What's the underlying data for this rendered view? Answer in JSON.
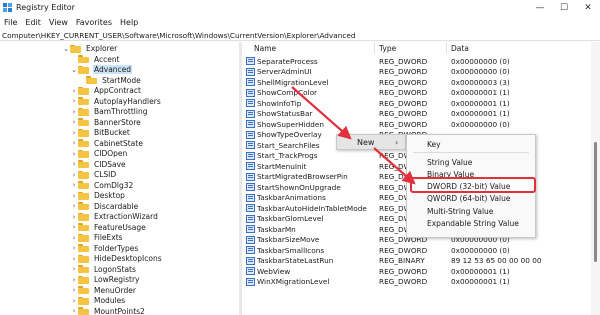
{
  "window": {
    "title": "Registry Editor",
    "controls": {
      "minimize": "—",
      "maximize": "☐",
      "close": "✕"
    }
  },
  "menu": [
    "File",
    "Edit",
    "View",
    "Favorites",
    "Help"
  ],
  "address": "Computer\\HKEY_CURRENT_USER\\Software\\Microsoft\\Windows\\CurrentVersion\\Explorer\\Advanced",
  "tree": [
    {
      "label": "Explorer",
      "expanded": true,
      "level": 0
    },
    {
      "label": "Accent",
      "expanded": false,
      "level": 1,
      "no_arrow": true
    },
    {
      "label": "Advanced",
      "expanded": true,
      "level": 1,
      "selected": true
    },
    {
      "label": "StartMode",
      "expanded": false,
      "level": 2,
      "no_arrow": true
    },
    {
      "label": "AppContract",
      "expanded": false,
      "level": 1
    },
    {
      "label": "AutoplayHandlers",
      "expanded": false,
      "level": 1
    },
    {
      "label": "BamThrottling",
      "expanded": false,
      "level": 1
    },
    {
      "label": "BannerStore",
      "expanded": false,
      "level": 1
    },
    {
      "label": "BitBucket",
      "expanded": false,
      "level": 1
    },
    {
      "label": "CabinetState",
      "expanded": false,
      "level": 1
    },
    {
      "label": "CIDOpen",
      "expanded": false,
      "level": 1
    },
    {
      "label": "CIDSave",
      "expanded": false,
      "level": 1
    },
    {
      "label": "CLSID",
      "expanded": false,
      "level": 1
    },
    {
      "label": "ComDlg32",
      "expanded": false,
      "level": 1
    },
    {
      "label": "Desktop",
      "expanded": false,
      "level": 1
    },
    {
      "label": "Discardable",
      "expanded": false,
      "level": 1
    },
    {
      "label": "ExtractionWizard",
      "expanded": false,
      "level": 1
    },
    {
      "label": "FeatureUsage",
      "expanded": false,
      "level": 1
    },
    {
      "label": "FileExts",
      "expanded": false,
      "level": 1
    },
    {
      "label": "FolderTypes",
      "expanded": false,
      "level": 1
    },
    {
      "label": "HideDesktopIcons",
      "expanded": false,
      "level": 1
    },
    {
      "label": "LogonStats",
      "expanded": false,
      "level": 1
    },
    {
      "label": "LowRegistry",
      "expanded": false,
      "level": 1
    },
    {
      "label": "MenuOrder",
      "expanded": false,
      "level": 1
    },
    {
      "label": "Modules",
      "expanded": false,
      "level": 1
    },
    {
      "label": "MountPoints2",
      "expanded": false,
      "level": 1
    }
  ],
  "columns": {
    "name": "Name",
    "type": "Type",
    "data": "Data"
  },
  "values": [
    {
      "name": "SeparateProcess",
      "type": "REG_DWORD",
      "data": "0x00000000 (0)"
    },
    {
      "name": "ServerAdminUI",
      "type": "REG_DWORD",
      "data": "0x00000000 (0)"
    },
    {
      "name": "ShellMigrationLevel",
      "type": "REG_DWORD",
      "data": "0x00000003 (3)"
    },
    {
      "name": "ShowCompColor",
      "type": "REG_DWORD",
      "data": "0x00000001 (1)"
    },
    {
      "name": "ShowInfoTip",
      "type": "REG_DWORD",
      "data": "0x00000001 (1)"
    },
    {
      "name": "ShowStatusBar",
      "type": "REG_DWORD",
      "data": "0x00000001 (1)"
    },
    {
      "name": "ShowSuperHidden",
      "type": "REG_DWORD",
      "data": "0x00000000 (0)"
    },
    {
      "name": "ShowTypeOverlay",
      "type": "REG_DWORD",
      "data": ""
    },
    {
      "name": "Start_SearchFiles",
      "type": "REG_DWORD",
      "data": ""
    },
    {
      "name": "Start_TrackProgs",
      "type": "REG_DWORD",
      "data": ""
    },
    {
      "name": "StartMenuInit",
      "type": "REG_DWORD",
      "data": ""
    },
    {
      "name": "StartMigratedBrowserPin",
      "type": "REG_DWORD",
      "data": ""
    },
    {
      "name": "StartShownOnUpgrade",
      "type": "REG_DWORD",
      "data": ""
    },
    {
      "name": "TaskbarAnimations",
      "type": "REG_DWORD",
      "data": ""
    },
    {
      "name": "TaskbarAutoHideInTabletMode",
      "type": "REG_DWORD",
      "data": ""
    },
    {
      "name": "TaskbarGlomLevel",
      "type": "REG_DWORD",
      "data": ""
    },
    {
      "name": "TaskbarMn",
      "type": "REG_DWORD",
      "data": "0x00000000 (0)"
    },
    {
      "name": "TaskbarSizeMove",
      "type": "REG_DWORD",
      "data": "0x00000000 (0)"
    },
    {
      "name": "TaskbarSmallIcons",
      "type": "REG_DWORD",
      "data": "0x00000000 (0)"
    },
    {
      "name": "TaskbarStateLastRun",
      "type": "REG_BINARY",
      "data": "89 12 53 65 00 00 00 00"
    },
    {
      "name": "WebView",
      "type": "REG_DWORD",
      "data": "0x00000001 (1)"
    },
    {
      "name": "WinXMigrationLevel",
      "type": "REG_DWORD",
      "data": "0x00000001 (1)"
    }
  ],
  "context_menu": {
    "new_label": "New",
    "arrow": "›"
  },
  "submenu": [
    {
      "label": "Key"
    },
    {
      "separator": true
    },
    {
      "label": "String Value"
    },
    {
      "label": "Binary Value"
    },
    {
      "label": "DWORD (32-bit) Value",
      "highlighted": true
    },
    {
      "label": "QWORD (64-bit) Value"
    },
    {
      "label": "Multi-String Value"
    },
    {
      "label": "Expandable String Value"
    }
  ],
  "colors": {
    "annotation_red": "#e0313d",
    "folder_yellow": "#f5c443",
    "selection_blue": "#cce4f7"
  }
}
